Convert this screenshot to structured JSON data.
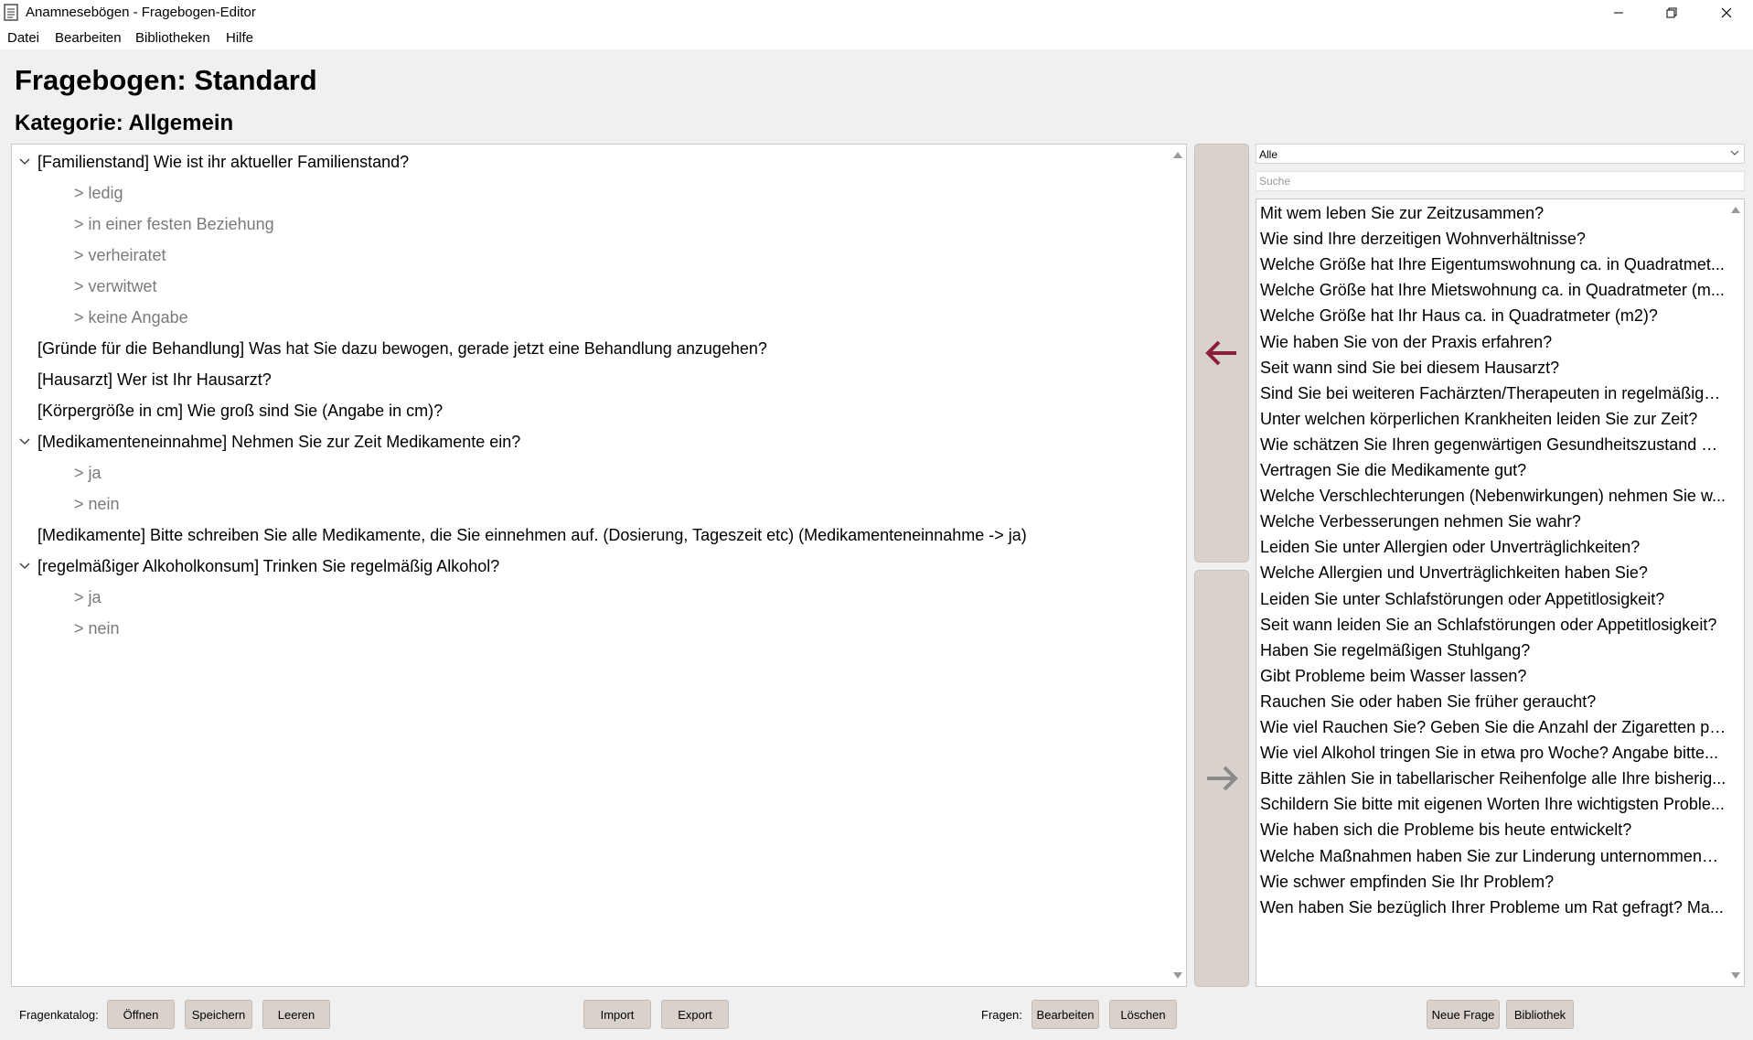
{
  "window": {
    "title": "Anamnesebögen - Fragebogen-Editor",
    "controls": [
      "minimize",
      "restore",
      "close"
    ]
  },
  "menu": [
    "Datei",
    "Bearbeiten",
    "Bibliotheken",
    "Hilfe"
  ],
  "heading": {
    "questionnaire": "Fragebogen: Standard",
    "category": "Kategorie: Allgemein"
  },
  "tree": [
    {
      "text": "[Familienstand] Wie ist ihr aktueller Familienstand?",
      "level": 0,
      "expanded": true
    },
    {
      "text": "> ledig",
      "level": 1
    },
    {
      "text": "> in einer festen Beziehung",
      "level": 1
    },
    {
      "text": "> verheiratet",
      "level": 1
    },
    {
      "text": "> verwitwet",
      "level": 1
    },
    {
      "text": "> keine Angabe",
      "level": 1
    },
    {
      "text": "[Gründe für die Behandlung] Was hat Sie dazu bewogen, gerade jetzt eine Behandlung anzugehen?",
      "level": 0
    },
    {
      "text": "[Hausarzt] Wer ist Ihr Hausarzt?",
      "level": 0
    },
    {
      "text": "[Körpergröße in cm] Wie groß sind Sie (Angabe in cm)?",
      "level": 0
    },
    {
      "text": "[Medikamenteneinnahme] Nehmen Sie zur Zeit Medikamente ein?",
      "level": 0,
      "expanded": true
    },
    {
      "text": "> ja",
      "level": 1
    },
    {
      "text": "> nein",
      "level": 1
    },
    {
      "text": "[Medikamente] Bitte schreiben Sie alle Medikamente, die Sie einnehmen auf. (Dosierung, Tageszeit etc) (Medikamenteneinnahme -> ja)",
      "level": 0
    },
    {
      "text": "[regelmäßiger Alkoholkonsum] Trinken Sie regelmäßig Alkohol?",
      "level": 0,
      "expanded": true
    },
    {
      "text": "> ja",
      "level": 1
    },
    {
      "text": "> nein",
      "level": 1
    }
  ],
  "move_buttons": {
    "left": {
      "icon": "arrow-left-icon",
      "color": "#8b1e3a"
    },
    "right": {
      "icon": "arrow-right-icon",
      "color": "#8a8a8a"
    }
  },
  "library": {
    "filter_value": "Alle",
    "search_placeholder": "Suche",
    "items": [
      "Mit wem leben Sie zur Zeitzusammen?",
      "Wie sind Ihre derzeitigen Wohnverhältnisse?",
      "Welche Größe hat Ihre Eigentumswohnung ca. in Quadratmet...",
      "Welche Größe hat Ihre Mietswohnung ca. in Quadratmeter (m...",
      "Welche Größe hat Ihr Haus ca. in Quadratmeter (m2)?",
      "Wie haben Sie von der Praxis erfahren?",
      "Seit wann sind Sie bei diesem Hausarzt?",
      "Sind Sie bei weiteren Fachärzten/Therapeuten in regelmäßiger...",
      "Unter welchen körperlichen Krankheiten leiden Sie zur Zeit?",
      "Wie schätzen Sie Ihren gegenwärtigen Gesundheitszustand ei...",
      "Vertragen Sie die Medikamente gut?",
      "Welche Verschlechterungen (Nebenwirkungen) nehmen Sie w...",
      "Welche Verbesserungen nehmen Sie wahr?",
      "Leiden Sie unter Allergien oder Unverträglichkeiten?",
      "Welche Allergien und Unverträglichkeiten haben Sie?",
      "Leiden Sie unter Schlafstörungen oder Appetitlosigkeit?",
      "Seit wann leiden Sie an Schlafstörungen oder Appetitlosigkeit?",
      "Haben Sie regelmäßigen Stuhlgang?",
      "Gibt Probleme beim Wasser lassen?",
      "Rauchen Sie oder haben Sie früher geraucht?",
      "Wie viel Rauchen Sie? Geben Sie die Anzahl der Zigaretten pr...",
      "Wie viel Alkohol tringen Sie in etwa pro Woche? Angabe bitte...",
      "Bitte zählen Sie in tabellarischer Reihenfolge alle Ihre bisherig...",
      "Schildern Sie bitte mit eigenen Worten Ihre wichtigsten Proble...",
      "Wie haben sich die Probleme bis heute entwickelt?",
      "Welche Maßnahmen haben Sie zur Linderung unternommen? ...",
      "Wie schwer empfinden Sie Ihr Problem?",
      "Wen haben Sie bezüglich Ihrer Probleme um Rat gefragt? Ma..."
    ]
  },
  "bottom": {
    "catalog_label": "Fragenkatalog:",
    "open": "Öffnen",
    "save": "Speichern",
    "clear": "Leeren",
    "import": "Import",
    "export": "Export",
    "questions_label": "Fragen:",
    "edit": "Bearbeiten",
    "delete": "Löschen",
    "new_question": "Neue Frage",
    "library": "Bibliothek"
  }
}
